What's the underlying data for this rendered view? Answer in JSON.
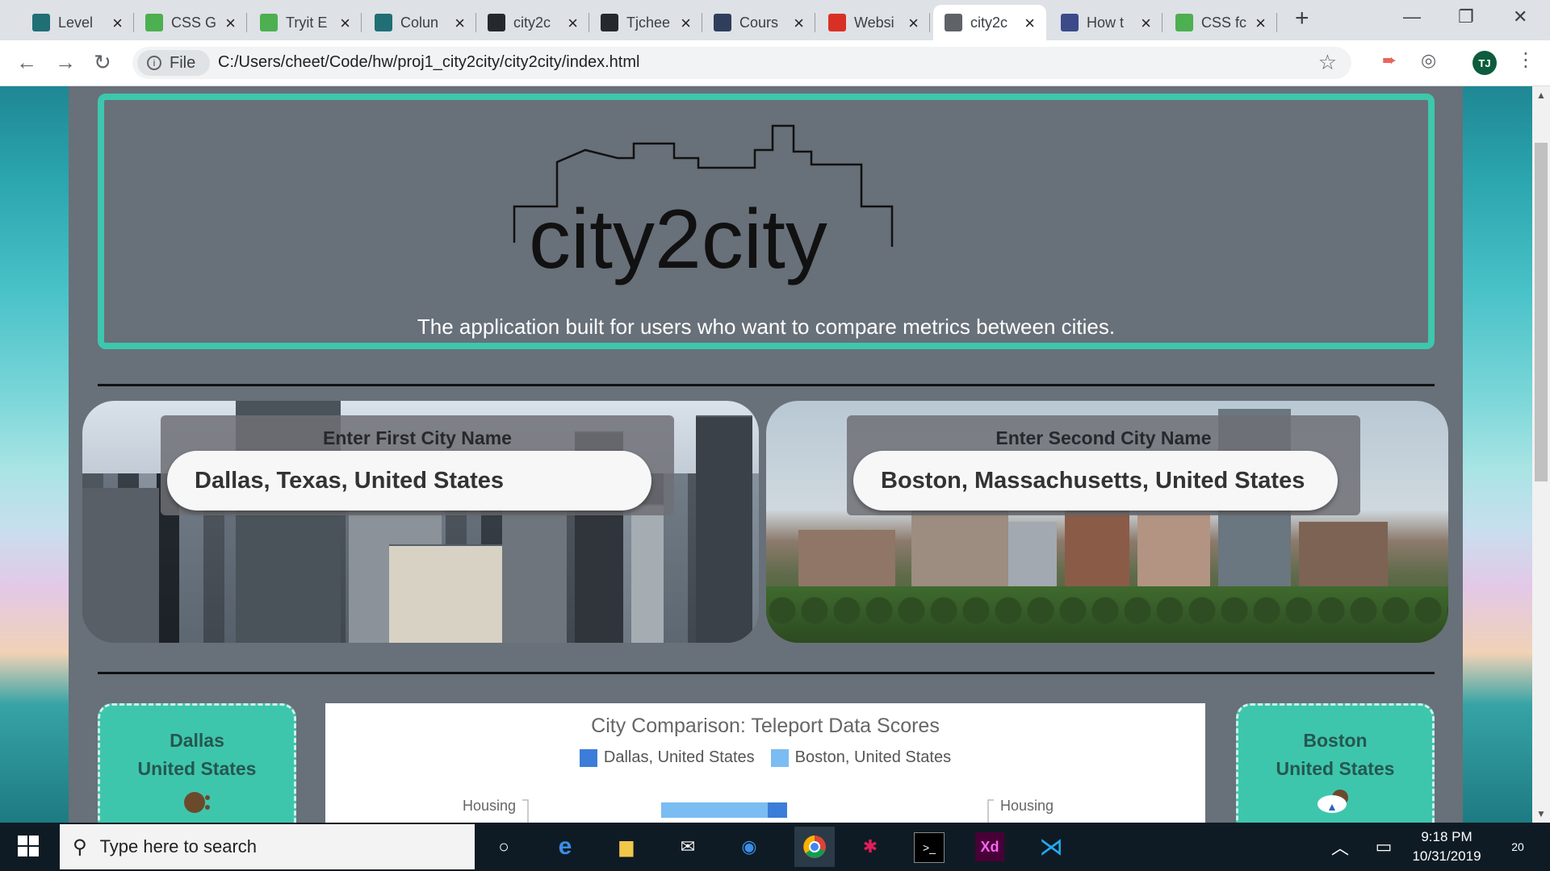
{
  "tabs": [
    {
      "title": "Level",
      "icon": "codecademy-icon",
      "color": "#1f6f75"
    },
    {
      "title": "CSS G",
      "icon": "w3schools-icon",
      "color": "#4caf50"
    },
    {
      "title": "Tryit E",
      "icon": "w3schools-icon",
      "color": "#4caf50"
    },
    {
      "title": "Colun",
      "icon": "codecademy-icon",
      "color": "#1f6f75"
    },
    {
      "title": "city2c",
      "icon": "github-icon",
      "color": "#24292e"
    },
    {
      "title": "Tjchee",
      "icon": "github-icon",
      "color": "#24292e"
    },
    {
      "title": "Cours",
      "icon": "shield-icon",
      "color": "#2f3e5c"
    },
    {
      "title": "Websi",
      "icon": "target-icon",
      "color": "#d93025"
    },
    {
      "title": "city2c",
      "icon": "globe-icon",
      "color": "#5f6368",
      "active": true
    },
    {
      "title": "How t",
      "icon": "w3-icon",
      "color": "#3c4a8a"
    },
    {
      "title": "CSS fc",
      "icon": "w3schools-icon",
      "color": "#4caf50"
    }
  ],
  "toolbar": {
    "site_chip": "File",
    "url": "C:/Users/cheet/Code/hw/proj1_city2city/city2city/index.html",
    "avatar": "TJ"
  },
  "hero": {
    "logo_text": "city2city",
    "tagline": "The application built for users who want to compare metrics between cities."
  },
  "search": {
    "first_label": "Enter First City Name",
    "first_value": "Dallas, Texas, United States",
    "second_label": "Enter Second City Name",
    "second_value": "Boston, Massachusetts, United States"
  },
  "cards": {
    "left_city": "Dallas",
    "left_country": "United States",
    "right_city": "Boston",
    "right_country": "United States"
  },
  "chart_data": {
    "type": "bar",
    "title": "City Comparison: Teleport Data Scores",
    "series": [
      {
        "name": "Dallas, United States",
        "color": "#3b7dd8"
      },
      {
        "name": "Boston, United States",
        "color": "#7bbcf2"
      }
    ],
    "categories": [
      "Housing"
    ],
    "category_label_left": "Housing",
    "category_label_right": "Housing"
  },
  "taskbar": {
    "search_placeholder": "Type here to search",
    "time": "9:18 PM",
    "date": "10/31/2019",
    "notifications": "20"
  }
}
